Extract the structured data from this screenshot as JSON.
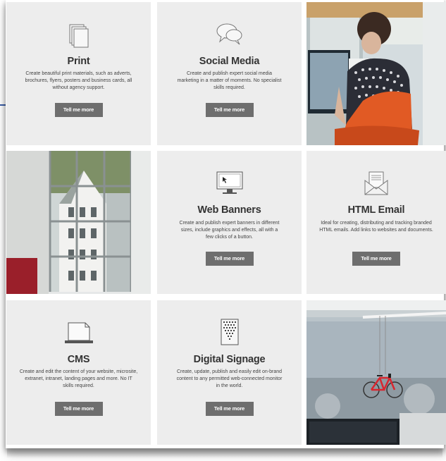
{
  "tiles": [
    {
      "title": "Print",
      "description": "Create beautiful print materials, such as adverts, brochures, flyers, posters and business cards, all without agency support.",
      "button": "Tell me more",
      "icon": "document-stack-icon"
    },
    {
      "title": "Social Media",
      "description": "Create and publish expert social media marketing in a matter of moments. No specialist skills required.",
      "button": "Tell me more",
      "icon": "speech-bubbles-icon"
    },
    {
      "title": "Web Banners",
      "description": "Create and publish expert banners in different sizes, include graphics and effects, all with a few clicks of a button.",
      "button": "Tell me more",
      "icon": "monitor-cursor-icon"
    },
    {
      "title": "HTML Email",
      "description": "Ideal for creating, distributing and tracking branded HTML emails. Add links to websites and documents.",
      "button": "Tell me more",
      "icon": "envelope-icon"
    },
    {
      "title": "CMS",
      "description": "Create and edit the content of your website, microsite, extranet, intranet, landing pages and more. No IT skills required.",
      "button": "Tell me more",
      "icon": "laptop-icon"
    },
    {
      "title": "Digital Signage",
      "description": "Create, update, publish and easily edit on-brand content to any permitted web-connected monitor in the world.",
      "button": "Tell me more",
      "icon": "signage-screen-icon"
    }
  ],
  "photos": [
    {
      "name": "woman-at-desk-photo"
    },
    {
      "name": "window-building-photo"
    },
    {
      "name": "hanging-bicycle-photo"
    }
  ]
}
